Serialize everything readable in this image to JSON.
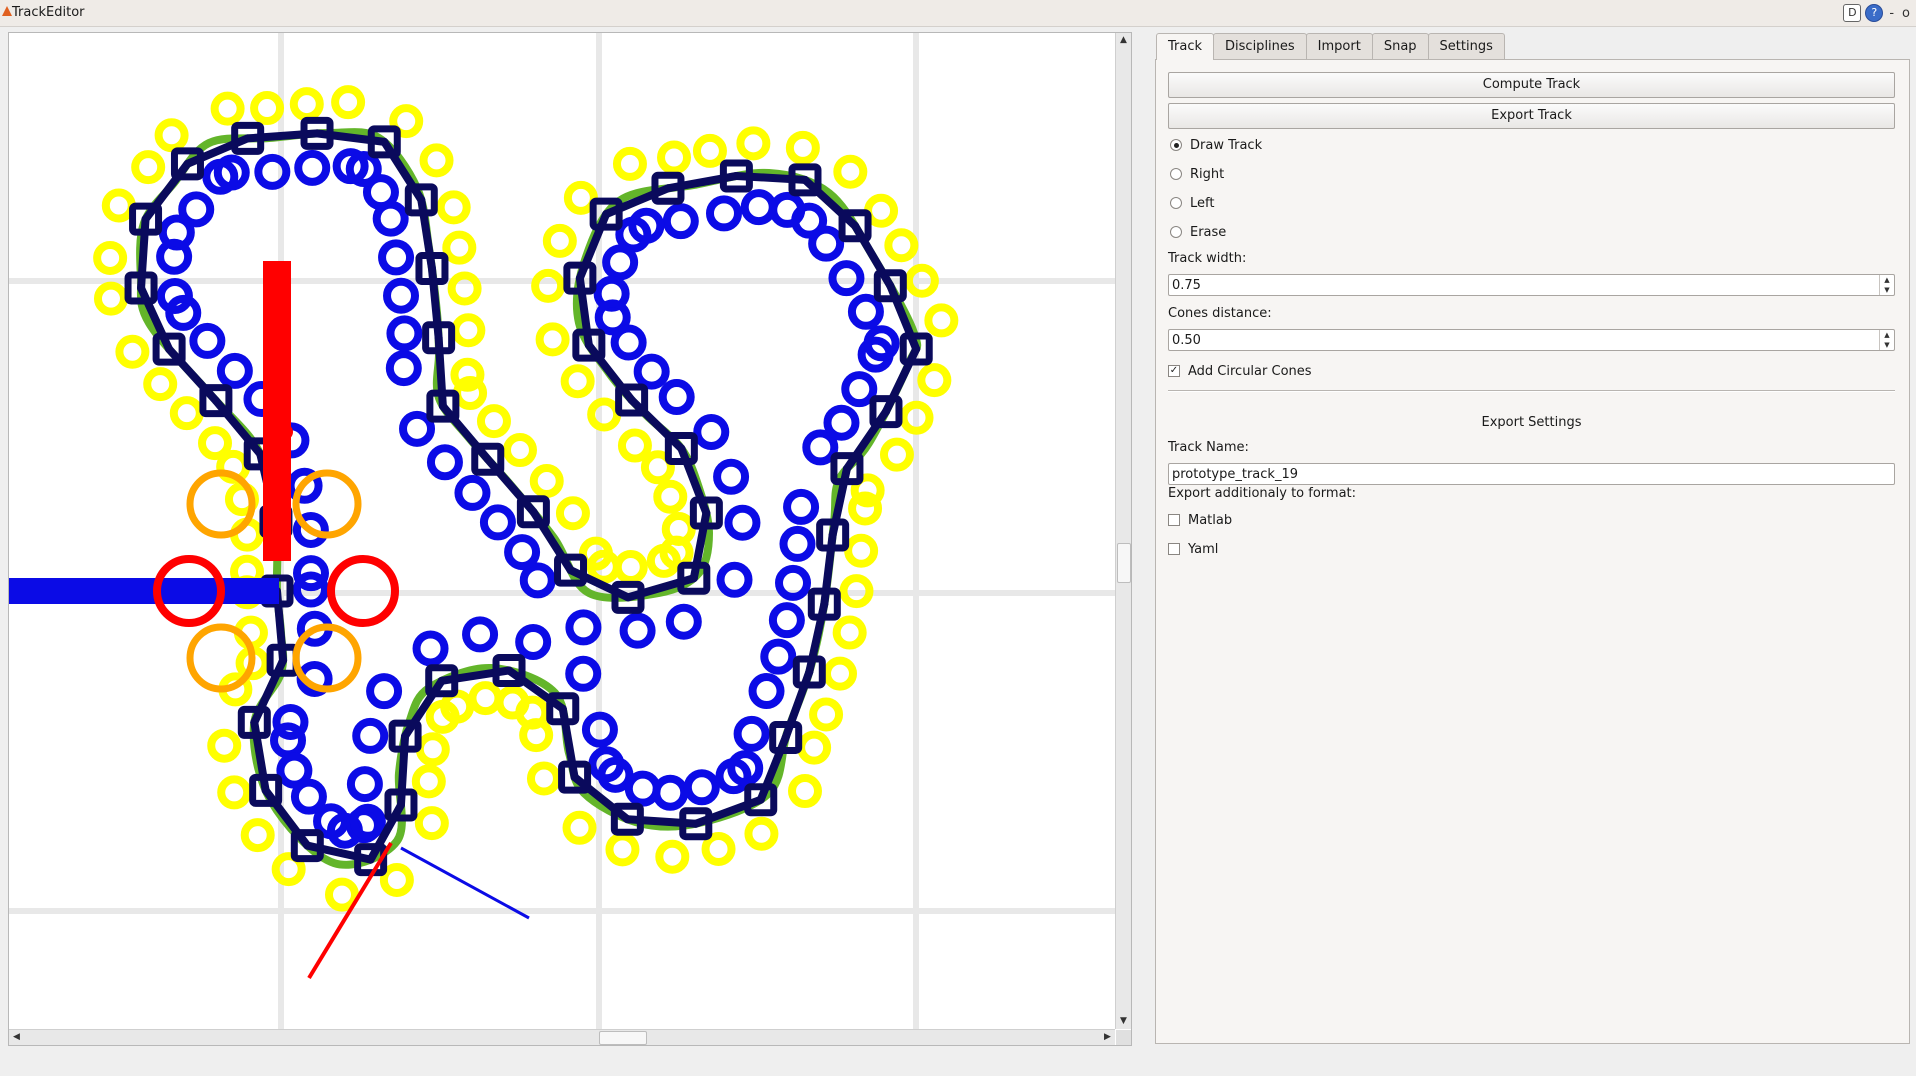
{
  "window": {
    "title": "TrackEditor",
    "buttons": [
      "D",
      "?",
      "-",
      "o"
    ]
  },
  "colors": {
    "blue_cone": "#0b0be6",
    "yellow_cone": "#ffff00",
    "track_line": "#63b52a",
    "segment": "#0a0a5c",
    "orange_cone": "#ffa500",
    "red": "#ff0000",
    "grid": "#e8e8e8"
  },
  "tabs": [
    {
      "label": "Track",
      "active": true
    },
    {
      "label": "Disciplines",
      "active": false
    },
    {
      "label": "Import",
      "active": false
    },
    {
      "label": "Snap",
      "active": false
    },
    {
      "label": "Settings",
      "active": false
    }
  ],
  "track_panel": {
    "compute_button": "Compute Track",
    "export_button": "Export Track",
    "modes": [
      {
        "label": "Draw Track",
        "checked": true
      },
      {
        "label": "Right",
        "checked": false
      },
      {
        "label": "Left",
        "checked": false
      },
      {
        "label": "Erase",
        "checked": false
      }
    ],
    "track_width_label": "Track width:",
    "track_width_value": "0.75",
    "cones_distance_label": "Cones distance:",
    "cones_distance_value": "0.50",
    "circular_cones_label": "Add Circular Cones",
    "circular_cones_checked": true,
    "export_settings_title": "Export Settings",
    "track_name_label": "Track Name:",
    "track_name_value": "prototype_track_19",
    "export_format_label": "Export additionaly to format:",
    "formats": [
      {
        "label": "Matlab",
        "checked": false
      },
      {
        "label": "Yaml",
        "checked": false
      }
    ]
  }
}
